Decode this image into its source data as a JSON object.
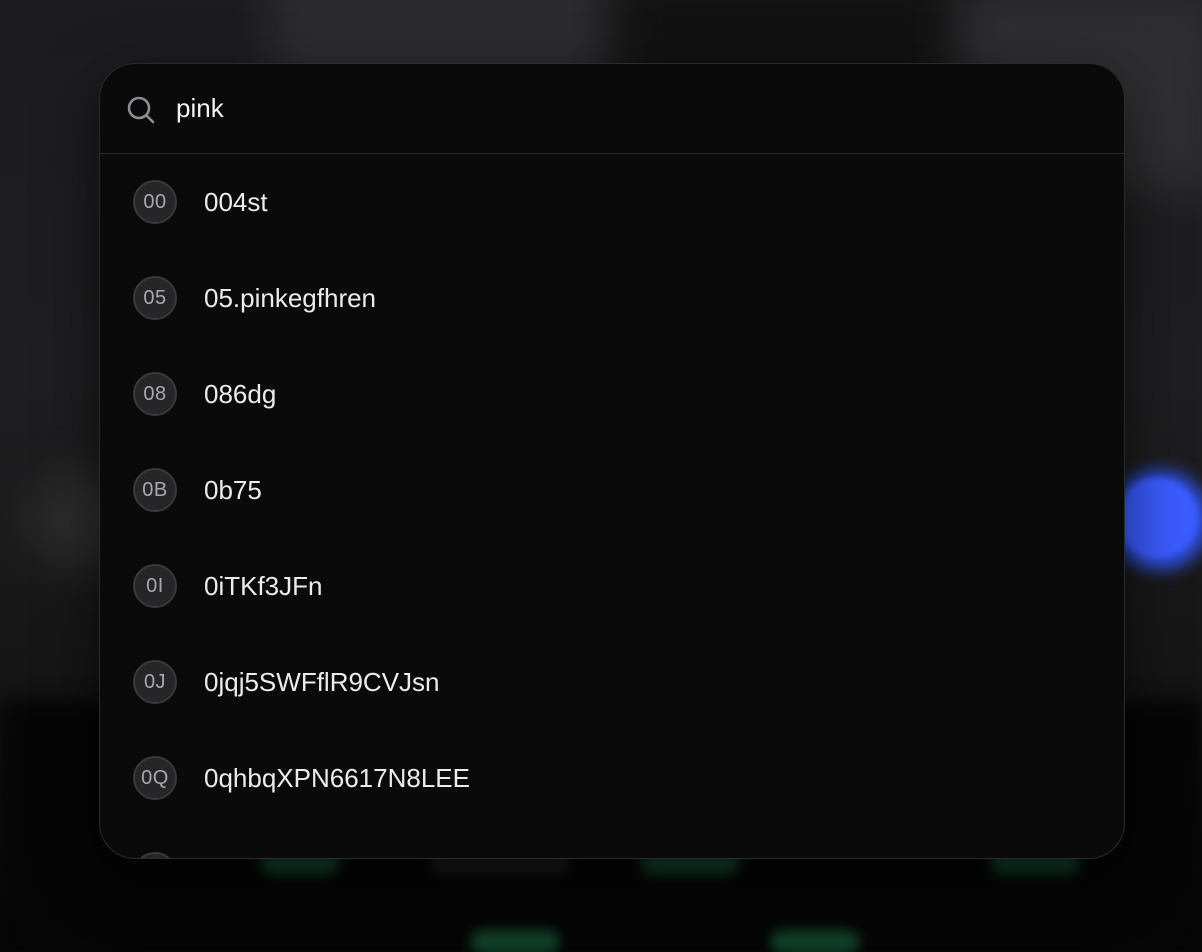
{
  "search": {
    "value": "pink",
    "icon": "search-icon"
  },
  "results": [
    {
      "initials": "00",
      "label": "004st"
    },
    {
      "initials": "05",
      "label": "05.pinkegfhren"
    },
    {
      "initials": "08",
      "label": "086dg"
    },
    {
      "initials": "0B",
      "label": "0b75"
    },
    {
      "initials": "0I",
      "label": "0iTKf3JFn"
    },
    {
      "initials": "0J",
      "label": "0jqj5SWFflR9CVJsn"
    },
    {
      "initials": "0Q",
      "label": "0qhbqXPN6617N8LEE"
    },
    {
      "initials": "",
      "label": ""
    }
  ],
  "colors": {
    "panel": "#0a0a0b",
    "accent_blue": "#3b5cff",
    "text": "#ececee",
    "avatar_text": "#a9a9ad"
  }
}
